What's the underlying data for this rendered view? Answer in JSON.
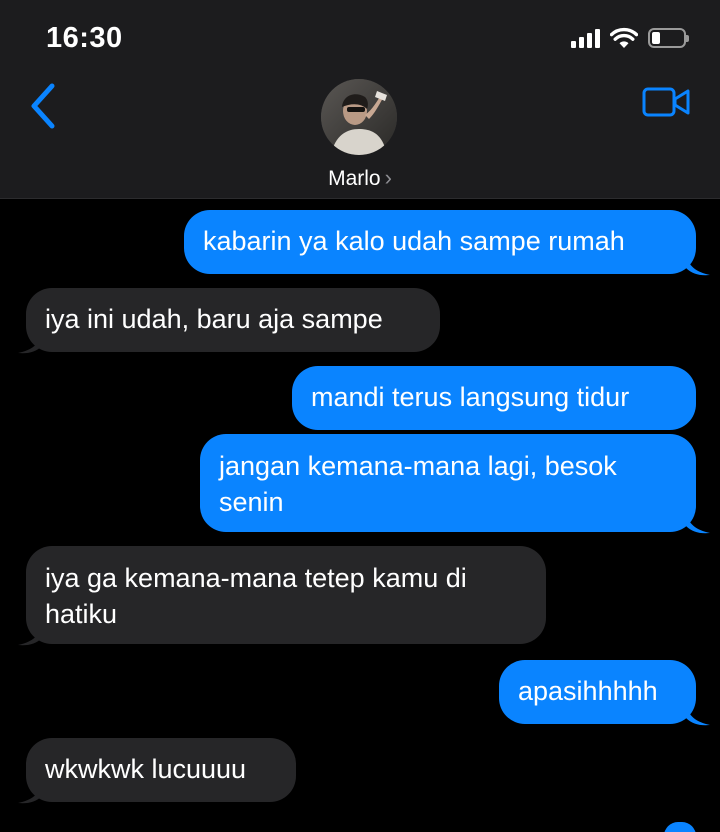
{
  "status_bar": {
    "time": "16:30",
    "battery_level": 0.25
  },
  "header": {
    "contact_name": "Marlo",
    "chevron": "›",
    "icons": [
      "chevron-left-icon",
      "video-camera-icon",
      "signal-icon",
      "wifi-icon",
      "battery-icon"
    ]
  },
  "colors": {
    "accent": "#0a84ff",
    "outgoing_bubble": "#0a84ff",
    "incoming_bubble": "#262628",
    "header_bg": "#1c1c1e",
    "background": "#000000"
  },
  "messages": [
    {
      "direction": "out",
      "text": "kabarin ya kalo udah sampe rumah"
    },
    {
      "direction": "in",
      "text": "iya ini udah, baru aja sampe"
    },
    {
      "direction": "out",
      "text": "mandi terus langsung tidur"
    },
    {
      "direction": "out",
      "text": "jangan kemana-mana lagi, besok senin"
    },
    {
      "direction": "in",
      "text": "iya ga kemana-mana tetep kamu di hatiku"
    },
    {
      "direction": "out",
      "text": "apasihhhhh"
    },
    {
      "direction": "in",
      "text": "wkwkwk lucuuuu"
    }
  ]
}
